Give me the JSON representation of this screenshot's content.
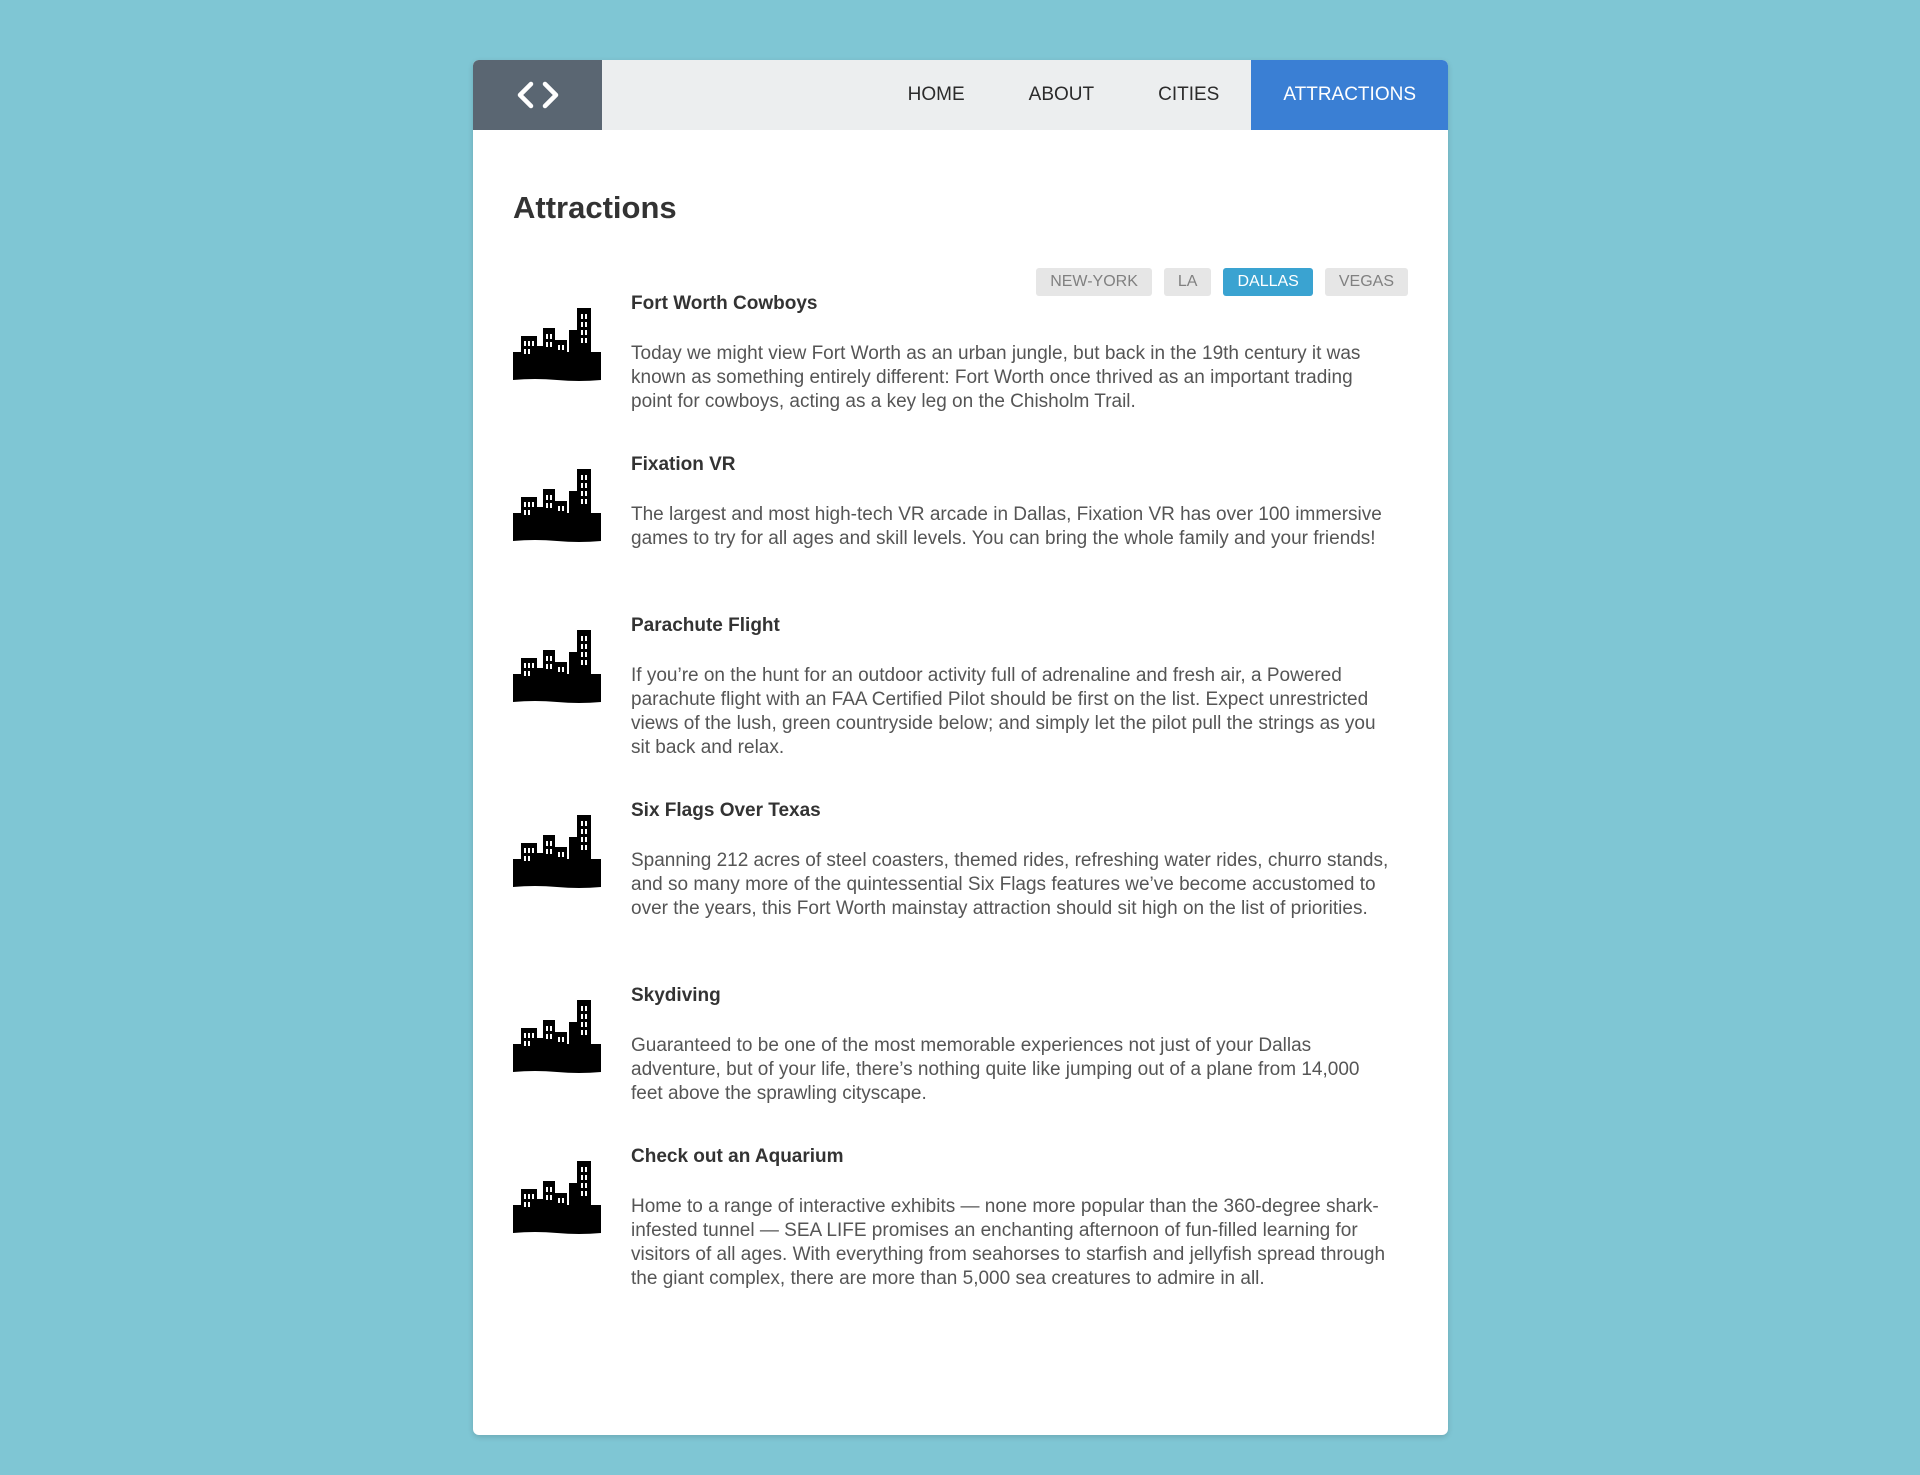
{
  "nav": {
    "logo_icon": "code-brackets-icon",
    "items": [
      {
        "label": "HOME"
      },
      {
        "label": "ABOUT"
      },
      {
        "label": "CITIES"
      },
      {
        "label": "ATTRACTIONS",
        "active": true
      }
    ]
  },
  "page": {
    "title": "Attractions"
  },
  "filters": [
    {
      "label": "NEW-YORK"
    },
    {
      "label": "LA"
    },
    {
      "label": "DALLAS",
      "active": true
    },
    {
      "label": "VEGAS"
    }
  ],
  "attractions": [
    {
      "icon": "city-skyline-icon",
      "title": "Fort Worth Cowboys",
      "description": "Today we might view Fort Worth as an urban jungle, but back in the 19th century it was known as something entirely different: Fort Worth once thrived as an important trading point for cowboys, acting as a key leg on the Chisholm Trail."
    },
    {
      "icon": "city-skyline-icon",
      "title": "Fixation VR",
      "description": "The largest and most high-tech VR arcade in Dallas, Fixation VR has over 100 immersive games to try for all ages and skill levels. You can bring the whole family and your friends!"
    },
    {
      "icon": "city-skyline-icon",
      "title": "Parachute Flight",
      "description": "If you’re on the hunt for an outdoor activity full of adrenaline and fresh air, a Powered parachute flight with an FAA Certified Pilot should be first on the list. Expect unrestricted views of the lush, green countryside below; and simply let the pilot pull the strings as you sit back and relax."
    },
    {
      "icon": "city-skyline-icon",
      "title": "Six Flags Over Texas",
      "description": "Spanning 212 acres of steel coasters, themed rides, refreshing water rides, churro stands, and so many more of the quintessential Six Flags features we’ve become accustomed to over the years, this Fort Worth mainstay attraction should sit high on the list of priorities."
    },
    {
      "icon": "city-skyline-icon",
      "title": "Skydiving",
      "description": "Guaranteed to be one of the most memorable experiences not just of your Dallas adventure, but of your life, there’s nothing quite like jumping out of a plane from 14,000 feet above the sprawling cityscape."
    },
    {
      "icon": "city-skyline-icon",
      "title": "Check out an Aquarium",
      "description": "Home to a range of interactive exhibits — none more popular than the 360-degree shark-infested tunnel — SEA LIFE promises an enchanting afternoon of fun-filled learning for visitors of all ages. With everything from seahorses to starfish and jellyfish spread through the giant complex, there are more than 5,000 sea creatures to admire in all."
    }
  ]
}
